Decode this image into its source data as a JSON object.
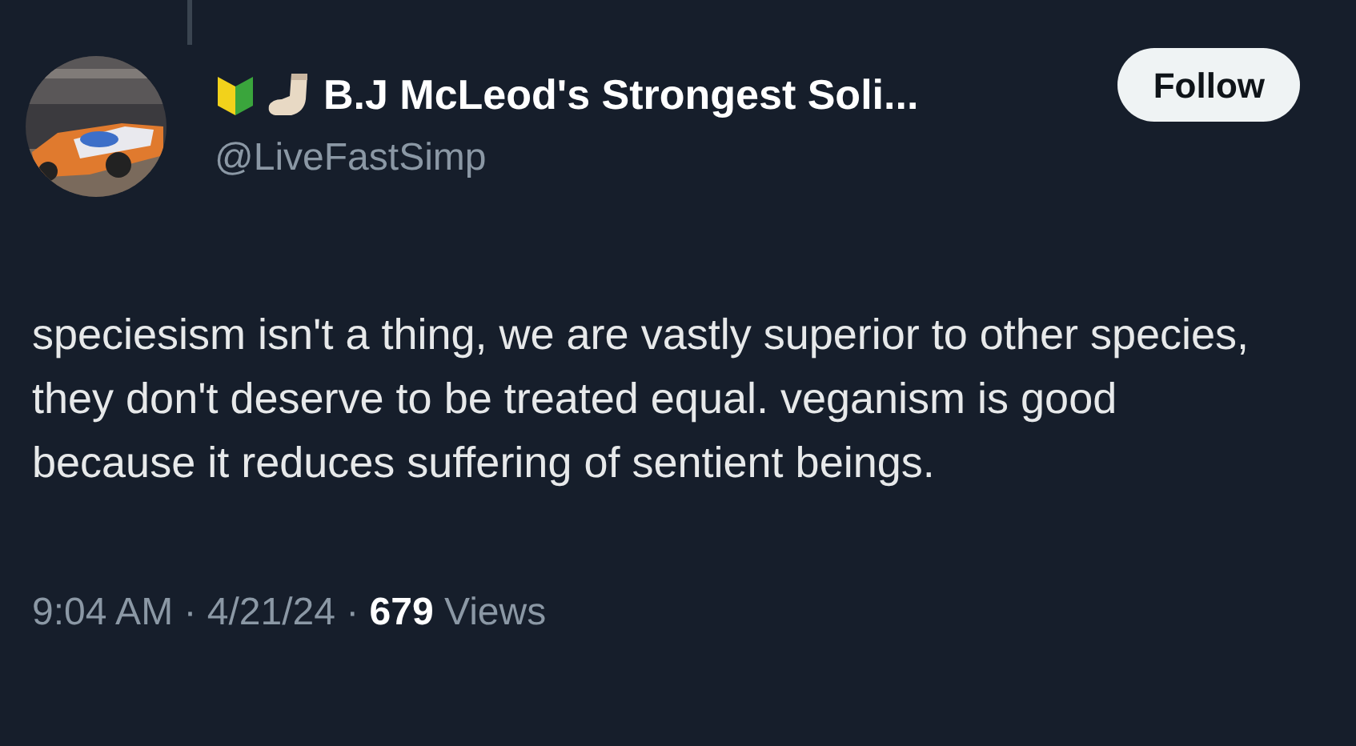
{
  "author": {
    "name": "B.J McLeod's Strongest Soli...",
    "handle": "@LiveFastSimp"
  },
  "follow_button": {
    "label": "Follow"
  },
  "post": {
    "text": "speciesism isn't a thing, we are vastly superior to other species, they don't deserve to be treated equal. veganism is good because it reduces suffering of sentient beings."
  },
  "meta": "9:04 AM · 4/21/24 · **679** Views"
}
